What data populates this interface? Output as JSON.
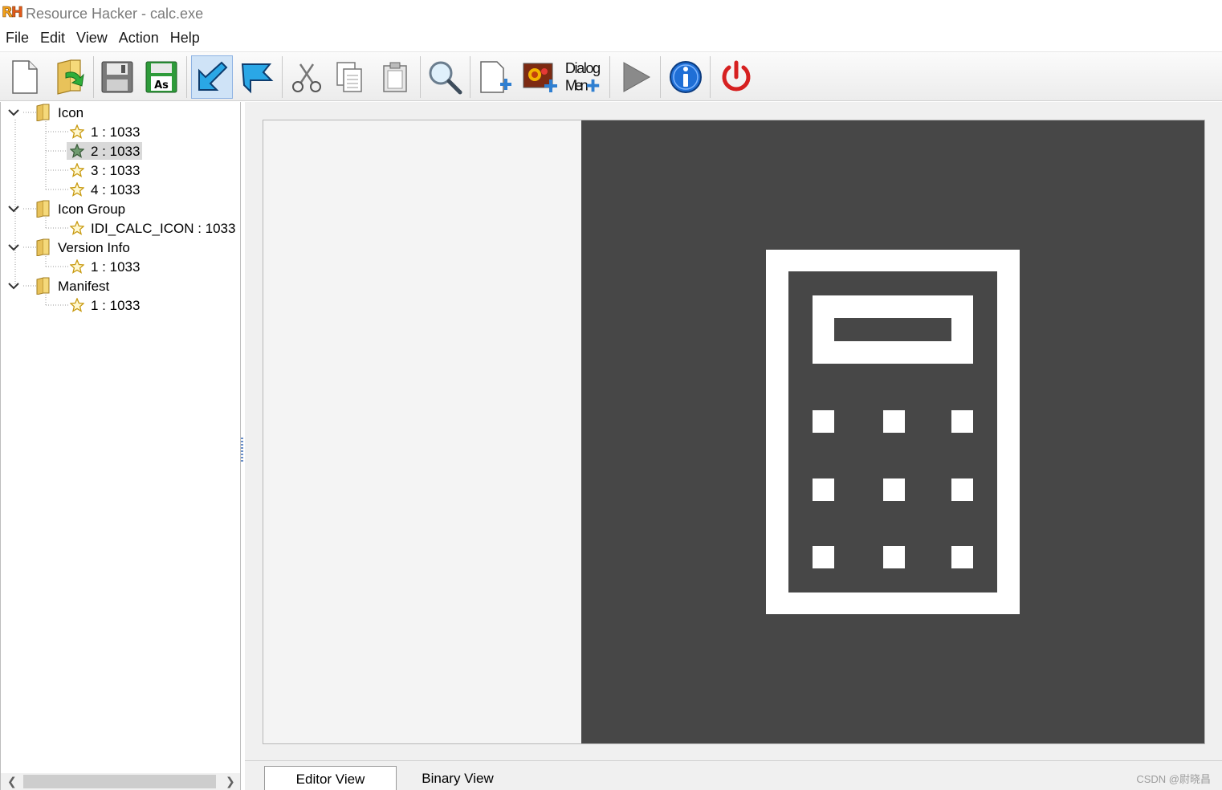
{
  "window": {
    "logo_r": "R",
    "logo_h": "H",
    "title": "Resource Hacker - calc.exe"
  },
  "menu": [
    "File",
    "Edit",
    "View",
    "Action",
    "Help"
  ],
  "toolbar": {
    "buttons": [
      {
        "name": "new-file",
        "icon": "blank-page-icon"
      },
      {
        "name": "open-file",
        "icon": "folder-arrow-icon"
      },
      {
        "name": "save",
        "icon": "floppy-icon"
      },
      {
        "name": "save-as",
        "icon": "floppy-as-icon",
        "text": "As"
      },
      {
        "name": "compile",
        "icon": "compile-arrow-icon",
        "pressed": true
      },
      {
        "name": "bookmark",
        "icon": "flag-arrow-icon"
      },
      {
        "name": "cut",
        "icon": "scissors-icon"
      },
      {
        "name": "copy",
        "icon": "copy-icon"
      },
      {
        "name": "paste",
        "icon": "clipboard-icon"
      },
      {
        "name": "find",
        "icon": "magnifier-icon"
      },
      {
        "name": "add-blank-resource",
        "icon": "page-plus-icon"
      },
      {
        "name": "add-image-resource",
        "icon": "image-plus-icon"
      },
      {
        "name": "dialog-merger",
        "icon": "dialog-menu-icon",
        "line1": "Dialog",
        "line2": "Men"
      },
      {
        "name": "run-script",
        "icon": "play-icon"
      },
      {
        "name": "about",
        "icon": "info-icon"
      },
      {
        "name": "exit",
        "icon": "power-icon"
      }
    ]
  },
  "tree": {
    "groups": [
      {
        "label": "Icon",
        "items": [
          "1 : 1033",
          "2 : 1033",
          "3 : 1033",
          "4 : 1033"
        ],
        "selected_index": 1
      },
      {
        "label": "Icon Group",
        "items": [
          "IDI_CALC_ICON : 1033"
        ]
      },
      {
        "label": "Version Info",
        "items": [
          "1 : 1033"
        ]
      },
      {
        "label": "Manifest",
        "items": [
          "1 : 1033"
        ]
      }
    ]
  },
  "tabs": {
    "editor": "Editor View",
    "binary": "Binary View",
    "active": "editor"
  },
  "watermark": "CSDN @尉晓昌",
  "colors": {
    "preview_bg": "#474747",
    "accent": "#2f7fd1",
    "star": "#f3c640",
    "selected_star": "#5c8a5c"
  }
}
